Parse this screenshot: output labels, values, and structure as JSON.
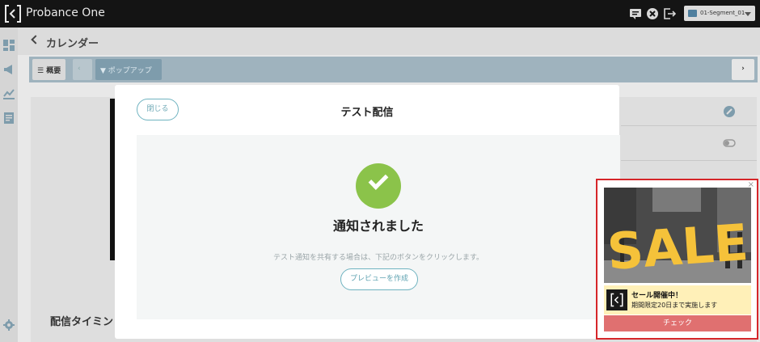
{
  "app": {
    "title": "Probance One"
  },
  "header": {
    "segment_label": "01-Segment_01"
  },
  "page": {
    "title": "カレンダー",
    "toolbar": {
      "overview_label": "概要",
      "prev_label": "‹",
      "popup_label": "ポップアップ",
      "next_label": "›"
    },
    "section_heading": "配信タイミン"
  },
  "modal": {
    "close_label": "閉じる",
    "title": "テスト配信",
    "success_title": "通知されました",
    "description": "テスト通知を共有する場合は、下記のボタンをクリックします。",
    "preview_button_label": "プレビューを作成"
  },
  "popup_preview": {
    "close_label": "×",
    "image_text": "SALE",
    "heading": "セール開催中！",
    "subtext": "期間限定20日まで実施します",
    "cta_label": "チェック",
    "colors": {
      "border": "#d6262a",
      "info_bg": "#fff0b8",
      "cta": "#e07070",
      "sale_text": "#f5c23a"
    }
  },
  "colors": {
    "topbar": "#141414",
    "success": "#8bc34a",
    "accent": "#6fb3c0"
  }
}
